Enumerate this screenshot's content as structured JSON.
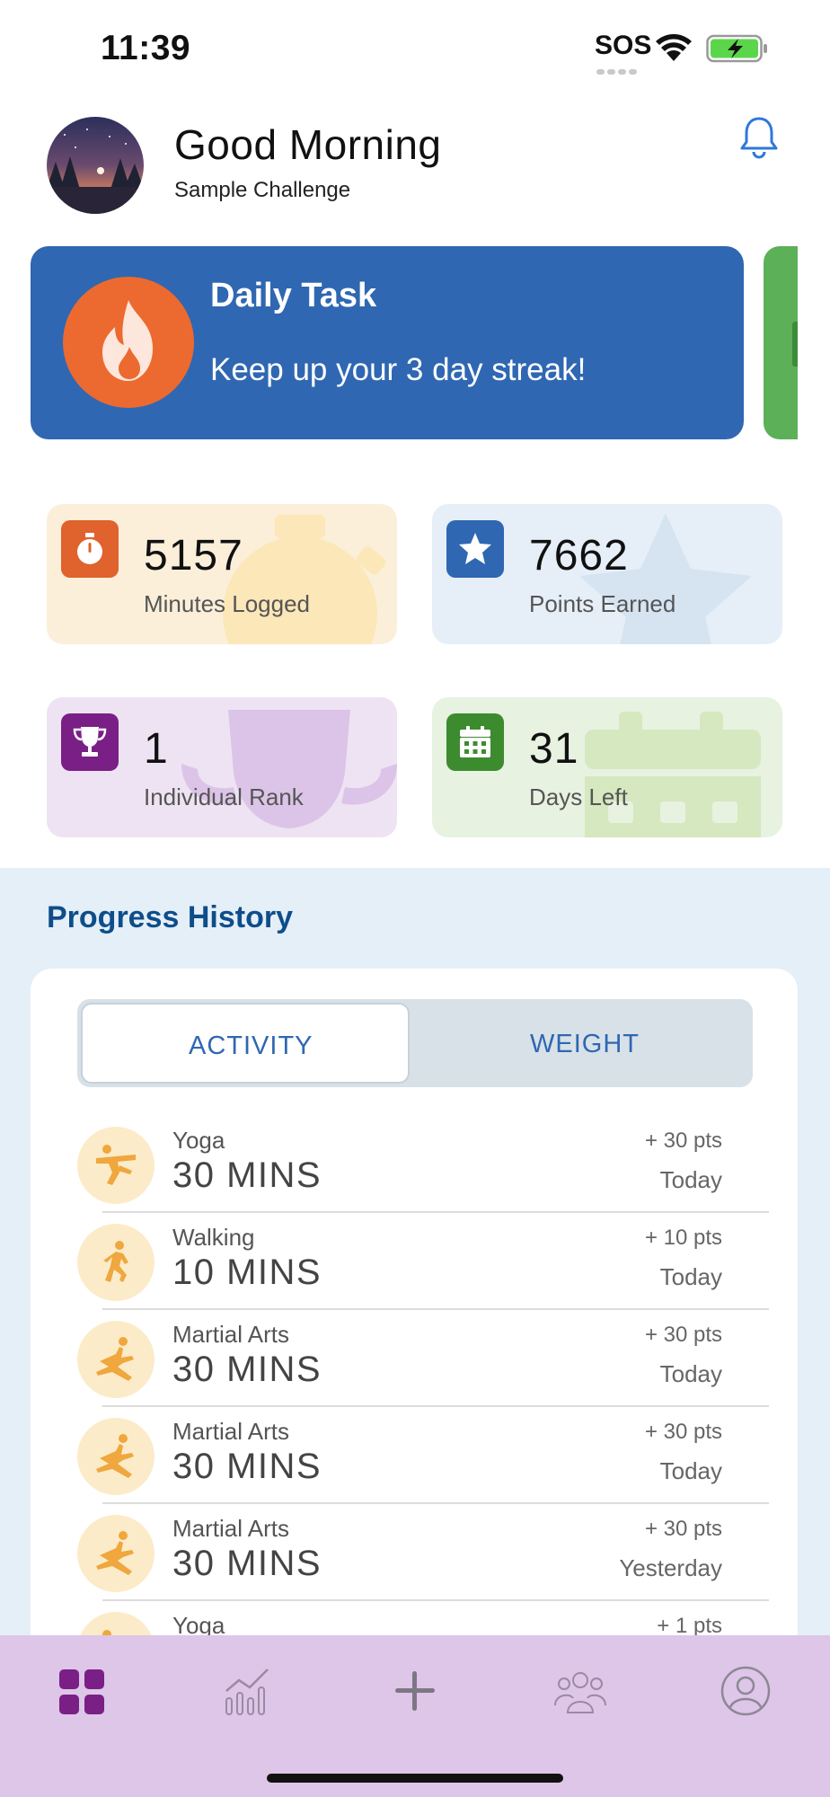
{
  "status_bar": {
    "time": "11:39",
    "sos": "SOS"
  },
  "header": {
    "greeting": "Good Morning",
    "challenge": "Sample Challenge",
    "avatar_icon": "night-forest-avatar",
    "notification_icon": "bell-icon"
  },
  "daily_task": {
    "title": "Daily Task",
    "message": "Keep up your 3 day streak!",
    "icon": "flame-icon",
    "accent": "#2f67b2"
  },
  "stats": [
    {
      "value": "5157",
      "label": "Minutes Logged",
      "icon": "stopwatch-icon",
      "color": "#e0622c"
    },
    {
      "value": "7662",
      "label": "Points Earned",
      "icon": "star-icon",
      "color": "#2f67b2"
    },
    {
      "value": "1",
      "label": "Individual Rank",
      "icon": "trophy-icon",
      "color": "#7a1f86"
    },
    {
      "value": "31",
      "label": "Days Left",
      "icon": "calendar-icon",
      "color": "#3d8b2f"
    }
  ],
  "progress_history": {
    "title": "Progress History",
    "tabs": [
      {
        "label": "ACTIVITY",
        "active": true
      },
      {
        "label": "WEIGHT",
        "active": false
      }
    ],
    "entries": [
      {
        "name": "Yoga",
        "amount": "30 MINS",
        "points": "+ 30 pts",
        "when": "Today",
        "icon": "yoga-icon"
      },
      {
        "name": "Walking",
        "amount": "10 MINS",
        "points": "+ 10 pts",
        "when": "Today",
        "icon": "walking-icon"
      },
      {
        "name": "Martial Arts",
        "amount": "30 MINS",
        "points": "+ 30 pts",
        "when": "Today",
        "icon": "martial-arts-icon"
      },
      {
        "name": "Martial Arts",
        "amount": "30 MINS",
        "points": "+ 30 pts",
        "when": "Today",
        "icon": "martial-arts-icon"
      },
      {
        "name": "Martial Arts",
        "amount": "30 MINS",
        "points": "+ 30 pts",
        "when": "Yesterday",
        "icon": "martial-arts-icon"
      },
      {
        "name": "Yoga",
        "amount": "",
        "points": "+ 1 pts",
        "when": "",
        "icon": "yoga-icon"
      }
    ]
  },
  "tab_bar": {
    "items": [
      {
        "icon": "dashboard-icon",
        "active": true
      },
      {
        "icon": "chart-icon",
        "active": false
      },
      {
        "icon": "plus-icon",
        "active": false
      },
      {
        "icon": "group-icon",
        "active": false
      },
      {
        "icon": "profile-icon",
        "active": false
      }
    ],
    "active_color": "#7a1f86"
  }
}
